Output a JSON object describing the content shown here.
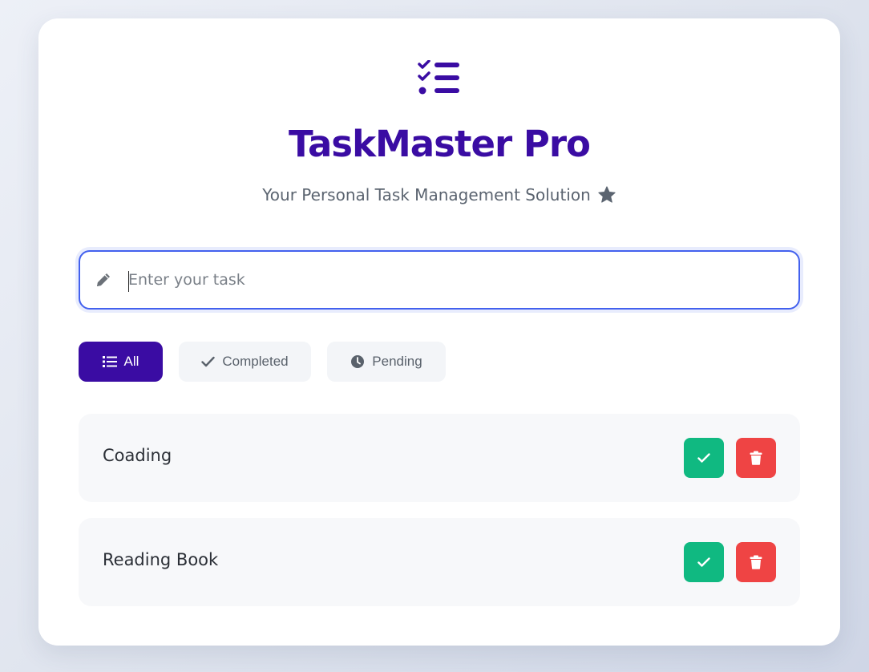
{
  "app": {
    "title": "TaskMaster Pro",
    "subtitle": "Your Personal Task Management Solution"
  },
  "input": {
    "placeholder": "Enter your task",
    "value": ""
  },
  "filters": [
    {
      "label": "All",
      "icon": "list-icon",
      "active": true
    },
    {
      "label": "Completed",
      "icon": "check-icon",
      "active": false
    },
    {
      "label": "Pending",
      "icon": "clock-icon",
      "active": false
    }
  ],
  "tasks": [
    {
      "text": "Coading"
    },
    {
      "text": "Reading Book"
    }
  ],
  "colors": {
    "primary": "#3a0ca3",
    "accent_border": "#4361ee",
    "complete": "#10b981",
    "delete": "#ef4444",
    "subtitle": "#5b6470"
  }
}
